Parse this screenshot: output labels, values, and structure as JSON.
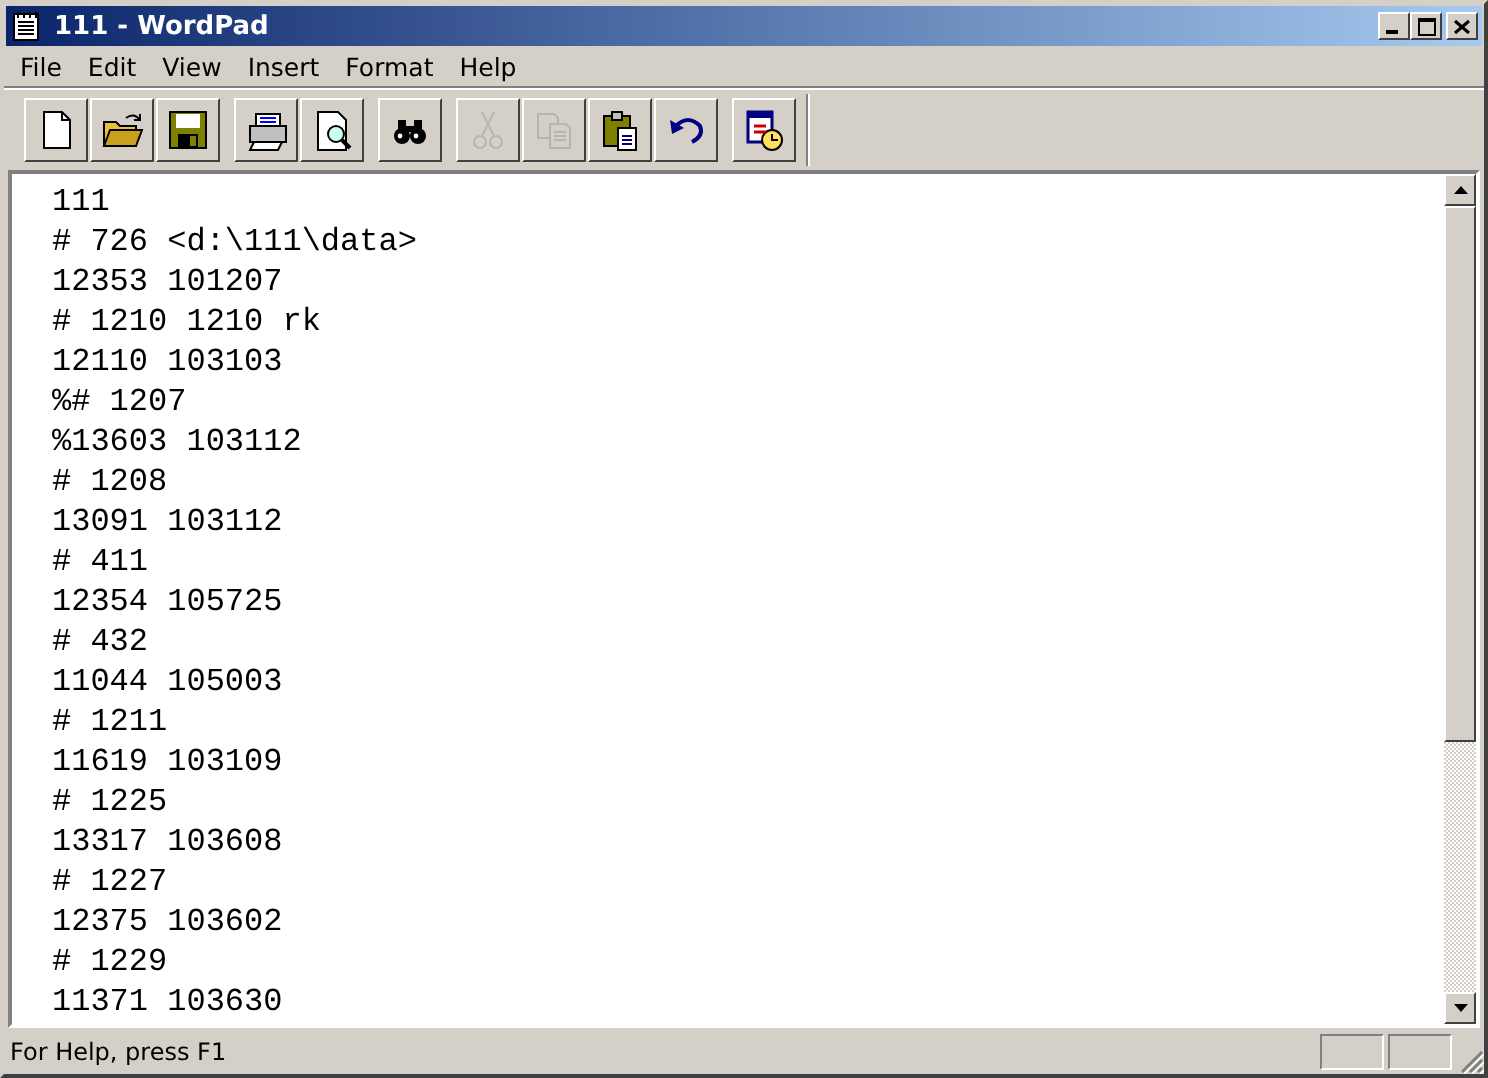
{
  "window": {
    "title": "111 - WordPad"
  },
  "menu": [
    {
      "label": "File"
    },
    {
      "label": "Edit"
    },
    {
      "label": "View"
    },
    {
      "label": "Insert"
    },
    {
      "label": "Format"
    },
    {
      "label": "Help"
    }
  ],
  "toolbar_groups": [
    [
      {
        "kind": "new",
        "disabled": false
      },
      {
        "kind": "open",
        "disabled": false
      },
      {
        "kind": "save",
        "disabled": false
      }
    ],
    [
      {
        "kind": "print",
        "disabled": false
      },
      {
        "kind": "preview",
        "disabled": false
      }
    ],
    [
      {
        "kind": "find",
        "disabled": false
      }
    ],
    [
      {
        "kind": "cut",
        "disabled": true
      },
      {
        "kind": "copy",
        "disabled": true
      },
      {
        "kind": "paste",
        "disabled": false
      },
      {
        "kind": "undo",
        "disabled": false
      }
    ],
    [
      {
        "kind": "datetime",
        "disabled": false
      }
    ]
  ],
  "document": {
    "lines": [
      "111",
      "# 726 <d:\\111\\data>",
      "12353 101207",
      "# 1210 1210 rk",
      "12110 103103",
      "%# 1207",
      "%13603 103112",
      "# 1208",
      "13091 103112",
      "# 411",
      "12354 105725",
      "# 432",
      "11044 105003",
      "# 1211",
      "11619 103109",
      "# 1225",
      "13317 103608",
      "# 1227",
      "12375 103602",
      "# 1229",
      "11371 103630"
    ]
  },
  "status_bar": {
    "text": "For Help, press F1"
  }
}
